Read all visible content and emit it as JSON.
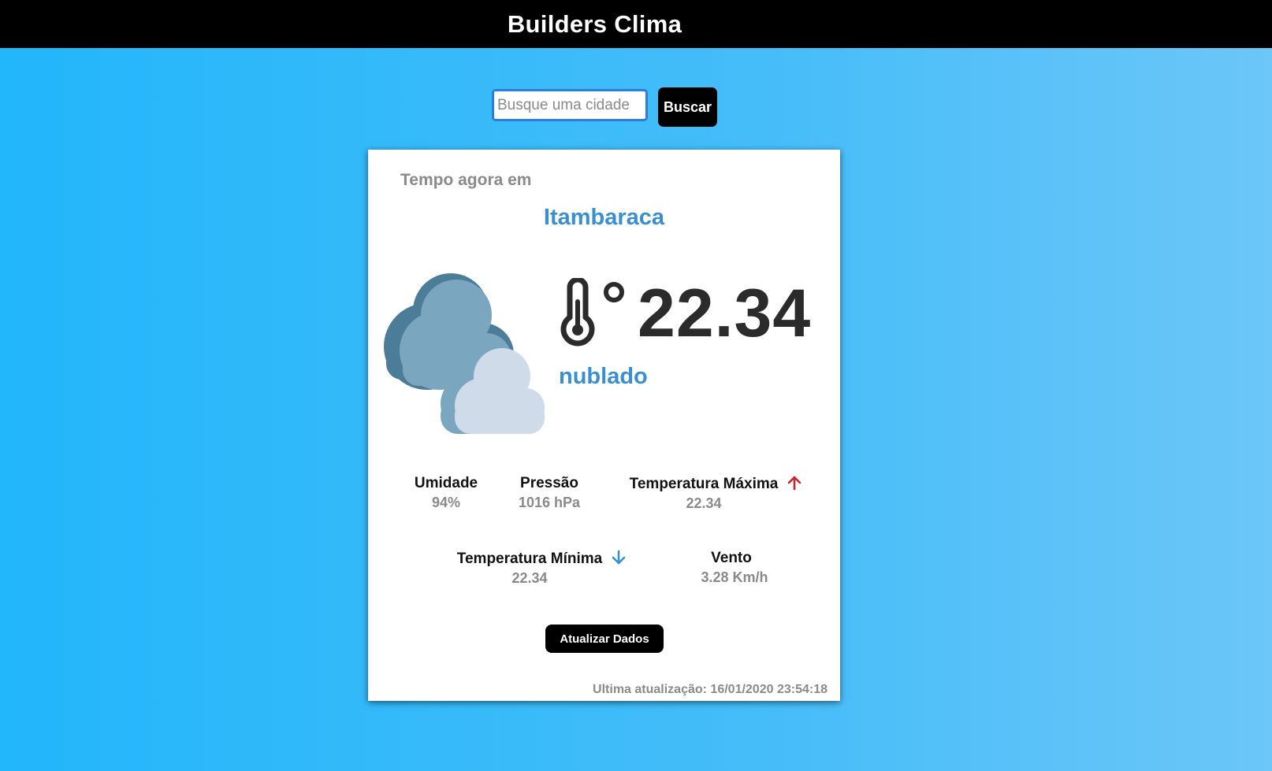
{
  "header": {
    "title": "Builders Clima"
  },
  "search": {
    "placeholder": "Busque uma cidade",
    "value": "",
    "button_label": "Buscar"
  },
  "weather": {
    "subtitle": "Tempo agora em",
    "city": "Itambaraca",
    "temperature": "22.34",
    "description": "nublado",
    "icons": {
      "condition": "cloud-icon",
      "thermometer": "thermometer-celsius-icon"
    },
    "stats": {
      "humidity": {
        "label": "Umidade",
        "value": "94%"
      },
      "pressure": {
        "label": "Pressão",
        "value": "1016 hPa"
      },
      "temp_max": {
        "label": "Temperatura Máxima",
        "value": "22.34",
        "icon": "arrow-up-icon"
      },
      "temp_min": {
        "label": "Temperatura Mínima",
        "value": "22.34",
        "icon": "arrow-down-icon"
      },
      "wind": {
        "label": "Vento",
        "value": "3.28 Km/h"
      }
    },
    "refresh_label": "Atualizar Dados",
    "last_update": "Ultima atualização: 16/01/2020 23:54:18"
  },
  "colors": {
    "accent_blue": "#3a8fd1",
    "arrow_up_red": "#c8232c",
    "arrow_down_blue": "#3a8fd1",
    "header_bg": "#000000",
    "background_gradient_start": "#22b6fa",
    "background_gradient_end": "#6cc6f8"
  }
}
